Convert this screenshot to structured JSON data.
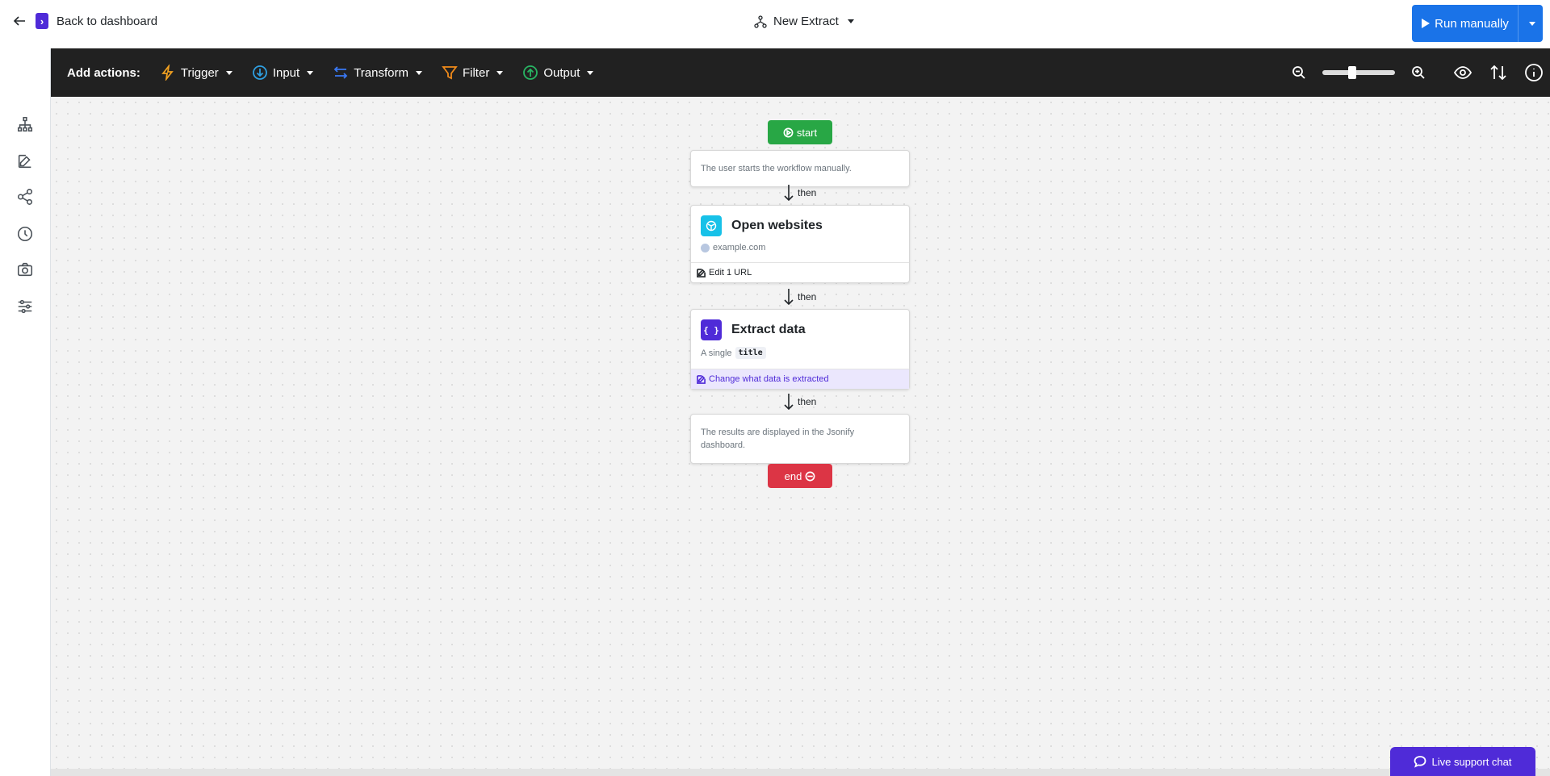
{
  "header": {
    "back_label": "Back to dashboard",
    "workflow_title": "New Extract",
    "run_label": "Run manually"
  },
  "toolbar": {
    "add_actions_label": "Add actions:",
    "menus": [
      {
        "label": "Trigger",
        "icon": "lightning-icon",
        "color": "#f0a020"
      },
      {
        "label": "Input",
        "icon": "arrow-down-circle-icon",
        "color": "#2f9fe0"
      },
      {
        "label": "Transform",
        "icon": "arrows-swap-icon",
        "color": "#3a78f2"
      },
      {
        "label": "Filter",
        "icon": "funnel-icon",
        "color": "#f08a1a"
      },
      {
        "label": "Output",
        "icon": "arrow-up-circle-icon",
        "color": "#28b463"
      }
    ],
    "zoom_level": 0.4
  },
  "sidebar": {
    "items": [
      {
        "name": "sitemap-icon"
      },
      {
        "name": "edit-icon"
      },
      {
        "name": "share-icon"
      },
      {
        "name": "history-icon"
      },
      {
        "name": "camera-icon"
      },
      {
        "name": "sliders-icon"
      }
    ]
  },
  "flow": {
    "start_label": "start",
    "start_note": "The user starts the workflow manually.",
    "then_label": "then",
    "open_websites": {
      "title": "Open websites",
      "url": "example.com",
      "edit_label": "Edit 1 URL"
    },
    "extract_data": {
      "title": "Extract data",
      "desc_prefix": "A single",
      "field": "title",
      "edit_label": "Change what data is extracted"
    },
    "end_note": "The results are displayed in the Jsonify dashboard.",
    "end_label": "end"
  },
  "support": {
    "label": "Live support chat"
  },
  "colors": {
    "brand": "#4f2bd8",
    "primary": "#1a73e8",
    "start": "#28a745",
    "end": "#dc3545",
    "toolbar_bg": "#212121"
  }
}
